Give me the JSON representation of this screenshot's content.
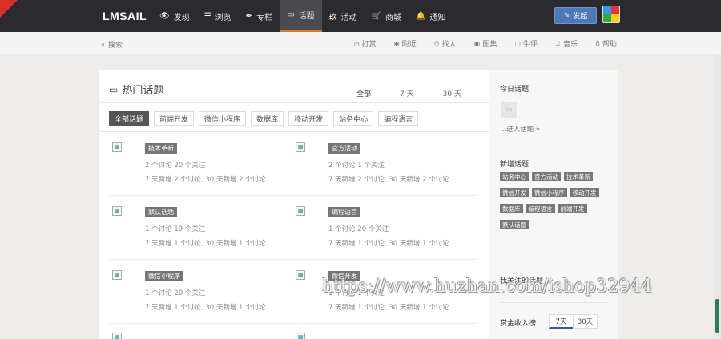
{
  "header": {
    "logo": "LMSAIL",
    "nav": [
      {
        "label": "发现",
        "icon": "eye-icon",
        "glyph": "👁"
      },
      {
        "label": "浏览",
        "icon": "list-icon",
        "glyph": "☰"
      },
      {
        "label": "专栏",
        "icon": "pen-icon",
        "glyph": "✒"
      },
      {
        "label": "话题",
        "icon": "chat-icon",
        "glyph": "▭"
      },
      {
        "label": "活动",
        "icon": "activity-icon",
        "glyph": "玖"
      },
      {
        "label": "商城",
        "icon": "cart-icon",
        "glyph": "🛒"
      },
      {
        "label": "通知",
        "icon": "bell-icon",
        "glyph": "🔔"
      }
    ],
    "active_nav": 3,
    "publish_label": "发起"
  },
  "subbar": {
    "search_label": "搜索",
    "items": [
      {
        "label": "打赏",
        "icon": "clock-icon",
        "glyph": "◷"
      },
      {
        "label": "附近",
        "icon": "location-icon",
        "glyph": "◉"
      },
      {
        "label": "找人",
        "icon": "users-icon",
        "glyph": "⚇"
      },
      {
        "label": "图集",
        "icon": "image-icon",
        "glyph": "▣"
      },
      {
        "label": "牛评",
        "icon": "comment-icon",
        "glyph": "▢"
      },
      {
        "label": "音乐",
        "icon": "headphones-icon",
        "glyph": "♫"
      },
      {
        "label": "帮助",
        "icon": "pin-icon",
        "glyph": "♁"
      }
    ]
  },
  "main": {
    "title": "热门话题",
    "range_tabs": [
      "全部",
      "7 天",
      "30 天"
    ],
    "active_range": 0,
    "tags": [
      "全部话题",
      "前端开发",
      "微信小程序",
      "数据库",
      "移动开发",
      "站务中心",
      "编程语言"
    ],
    "active_tag": 0,
    "topics": [
      {
        "label": "技术革新",
        "stat1": "2 个讨论 20 个关注",
        "stat2": "7 天新增 2 个讨论, 30 天新增 2 个讨论"
      },
      {
        "label": "官方活动",
        "stat1": "2 个讨论 1 个关注",
        "stat2": "7 天新增 2 个讨论, 30 天新增 2 个讨论"
      },
      {
        "label": "默认话题",
        "stat1": "1 个讨论 19 个关注",
        "stat2": "7 天新增 1 个讨论, 30 天新增 1 个讨论"
      },
      {
        "label": "编程语言",
        "stat1": "1 个讨论 20 个关注",
        "stat2": "7 天新增 1 个讨论, 30 天新增 1 个讨论"
      },
      {
        "label": "微信小程序",
        "stat1": "1 个讨论 20 个关注",
        "stat2": "7 天新增 1 个讨论, 30 天新增 1 个讨论"
      },
      {
        "label": "微信开发",
        "stat1": "1 个讨论 1 个关注",
        "stat2": "7 天新增 1 个讨论, 30 天新增 1 个讨论"
      }
    ]
  },
  "sidebar": {
    "today_title": "今日话题",
    "enter_link": "...进入话题 »",
    "new_title": "新增话题",
    "new_tags": [
      "站务中心",
      "官方活动",
      "技术革新",
      "微信开发",
      "微信小程序",
      "移动开发",
      "数据库",
      "编程语言",
      "前端开发",
      "默认话题"
    ],
    "follow_title": "我关注的话题",
    "reward_title": "赏金收入榜",
    "reward_tabs": [
      "7天",
      "30天"
    ],
    "active_reward": 0
  },
  "watermark": "https://www.huzhan.com/ishop32944"
}
